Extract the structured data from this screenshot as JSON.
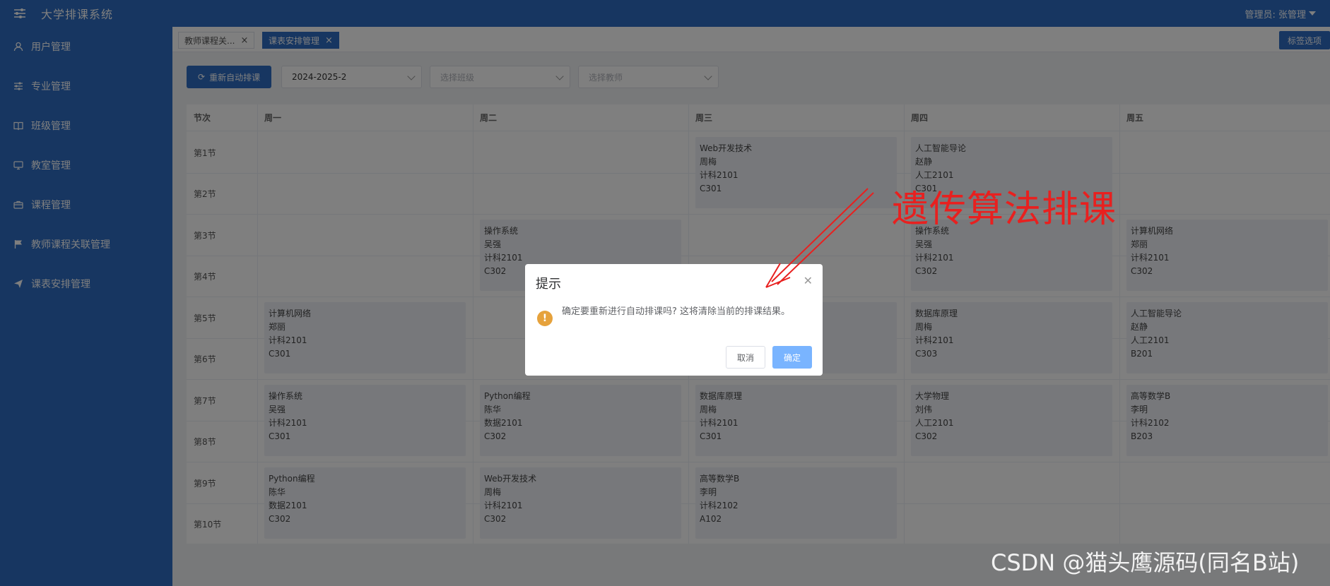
{
  "header": {
    "app_title": "大学排课系统",
    "user_label": "管理员: 张管理"
  },
  "sidebar": {
    "items": [
      {
        "label": "用户管理",
        "icon": "user-icon"
      },
      {
        "label": "专业管理",
        "icon": "sliders-icon"
      },
      {
        "label": "班级管理",
        "icon": "book-icon"
      },
      {
        "label": "教室管理",
        "icon": "monitor-icon"
      },
      {
        "label": "课程管理",
        "icon": "briefcase-icon"
      },
      {
        "label": "教师课程关联管理",
        "icon": "flag-icon"
      },
      {
        "label": "课表安排管理",
        "icon": "send-icon"
      }
    ]
  },
  "tabs": {
    "items": [
      {
        "label": "教师课程关..."
      },
      {
        "label": "课表安排管理"
      }
    ],
    "options_label": "标签选项"
  },
  "toolbar": {
    "auto_schedule_label": "重新自动排课",
    "semester_value": "2024-2025-2",
    "class_placeholder": "选择班级",
    "teacher_placeholder": "选择教师"
  },
  "timetable": {
    "header_period": "节次",
    "days": [
      "周一",
      "周二",
      "周三",
      "周四",
      "周五"
    ],
    "periods": [
      "第1节",
      "第2节",
      "第3节",
      "第4节",
      "第5节",
      "第6节",
      "第7节",
      "第8节",
      "第9节",
      "第10节"
    ],
    "courses": {
      "wed_1": [
        "Web开发技术",
        "周梅",
        "计科2101",
        "C301"
      ],
      "thu_1": [
        "人工智能导论",
        "赵静",
        "人工2101",
        "C301"
      ],
      "tue_3": [
        "操作系统",
        "吴强",
        "计科2101",
        "C302"
      ],
      "thu_3": [
        "操作系统",
        "吴强",
        "计科2101",
        "C302"
      ],
      "fri_3": [
        "计算机网络",
        "郑丽",
        "计科2101",
        "C302"
      ],
      "mon_5": [
        "计算机网络",
        "郑丽",
        "计科2101",
        "C301"
      ],
      "thu_5": [
        "数据库原理",
        "周梅",
        "计科2101",
        "C303"
      ],
      "fri_5": [
        "人工智能导论",
        "赵静",
        "人工2101",
        "B201"
      ],
      "mon_7": [
        "操作系统",
        "吴强",
        "计科2101",
        "C301"
      ],
      "tue_7": [
        "Python编程",
        "陈华",
        "数据2101",
        "C302"
      ],
      "wed_7": [
        "数据库原理",
        "周梅",
        "计科2101",
        "C301"
      ],
      "thu_7": [
        "大学物理",
        "刘伟",
        "人工2101",
        "C302"
      ],
      "fri_7": [
        "高等数学B",
        "李明",
        "计科2102",
        "B203"
      ],
      "mon_9": [
        "Python编程",
        "陈华",
        "数据2101",
        "C302"
      ],
      "tue_9": [
        "Web开发技术",
        "周梅",
        "计科2101",
        "C302"
      ],
      "wed_9": [
        "高等数学B",
        "李明",
        "计科2102",
        "A102"
      ]
    }
  },
  "dialog": {
    "title": "提示",
    "message": "确定要重新进行自动排课吗? 这将清除当前的排课结果。",
    "cancel_label": "取消",
    "confirm_label": "确定"
  },
  "annotation": {
    "text": "遗传算法排课",
    "color": "#e8201f"
  },
  "watermark": "CSDN @猫头鹰源码(同名B站)",
  "colors": {
    "primary": "#2e6dc2",
    "warning": "#e6a23c"
  }
}
